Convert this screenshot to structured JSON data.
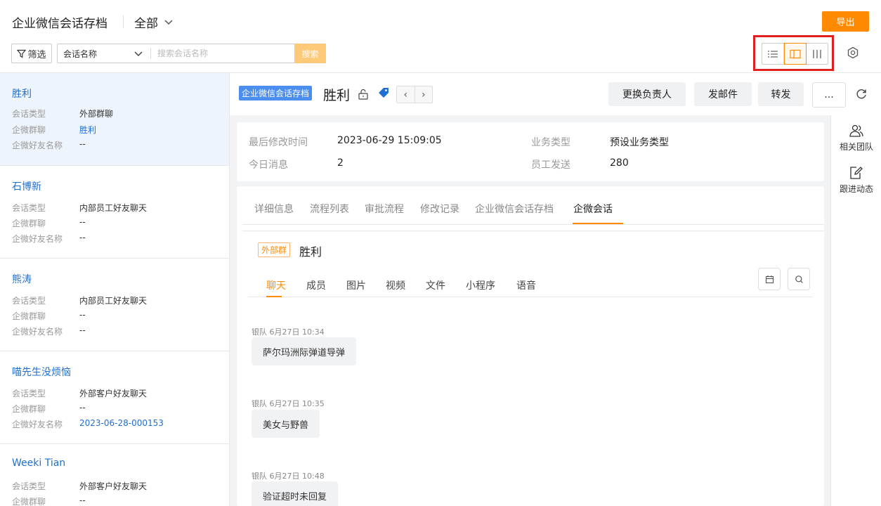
{
  "header": {
    "title": "企业微信会话存档",
    "scope": "全部",
    "export_label": "导出",
    "filter_label": "筛选",
    "search_field": "会话名称",
    "search_placeholder": "搜索会话名称",
    "search_button": "搜索",
    "view_modes": [
      "list-view",
      "split-view",
      "column-view"
    ],
    "active_view": "split-view"
  },
  "list": {
    "labels": {
      "type": "会话类型",
      "group": "企微群聊",
      "friend": "企微好友名称"
    },
    "items": [
      {
        "name": "胜利",
        "type": "外部群聊",
        "group": "胜利",
        "friend": "--"
      },
      {
        "name": "石博新",
        "type": "内部员工好友聊天",
        "group": "--",
        "friend": "--"
      },
      {
        "name": "熊涛",
        "type": "内部员工好友聊天",
        "group": "--",
        "friend": "--"
      },
      {
        "name": "喵先生没烦恼",
        "type": "外部客户好友聊天",
        "group": "--",
        "friend": "2023-06-28-000153"
      },
      {
        "name": "Weeki Tian",
        "type": "外部客户好友聊天",
        "group": "--",
        "friend": ""
      }
    ]
  },
  "detail": {
    "object_tag": "企业微信会话存档",
    "name": "胜利",
    "actions": {
      "change_owner": "更换负责人",
      "send_mail": "发邮件",
      "forward": "转发",
      "more": "..."
    },
    "info": {
      "modified_label": "最后修改时间",
      "modified_value": "2023-06-29 15:09:05",
      "biz_type_label": "业务类型",
      "biz_type_value": "预设业务类型",
      "today_msg_label": "今日消息",
      "today_msg_value": "2",
      "staff_sent_label": "员工发送",
      "staff_sent_value": "280"
    },
    "tabs": [
      "详细信息",
      "流程列表",
      "审批流程",
      "修改记录",
      "企业微信会话存档",
      "企微会话"
    ],
    "active_tab": "企微会话",
    "chat": {
      "group_tag": "外部群",
      "group_name": "胜利",
      "sub_tabs": [
        "聊天",
        "成员",
        "图片",
        "视频",
        "文件",
        "小程序",
        "语音"
      ],
      "active_sub_tab": "聊天",
      "messages": [
        {
          "meta": "银队 6月27日 10:34",
          "text": "萨尔玛洲际弹道导弹"
        },
        {
          "meta": "银队 6月27日 10:35",
          "text": "美女与野兽"
        },
        {
          "meta": "银队 6月27日 10:48",
          "text": "验证超时未回复"
        }
      ]
    }
  },
  "sidebar": {
    "team": "相关团队",
    "followup": "跟进动态"
  },
  "colors": {
    "accent": "#ff8a00",
    "link": "#1f6fd0",
    "tag_blue": "#4a8ef0",
    "highlight": "#e02020"
  }
}
